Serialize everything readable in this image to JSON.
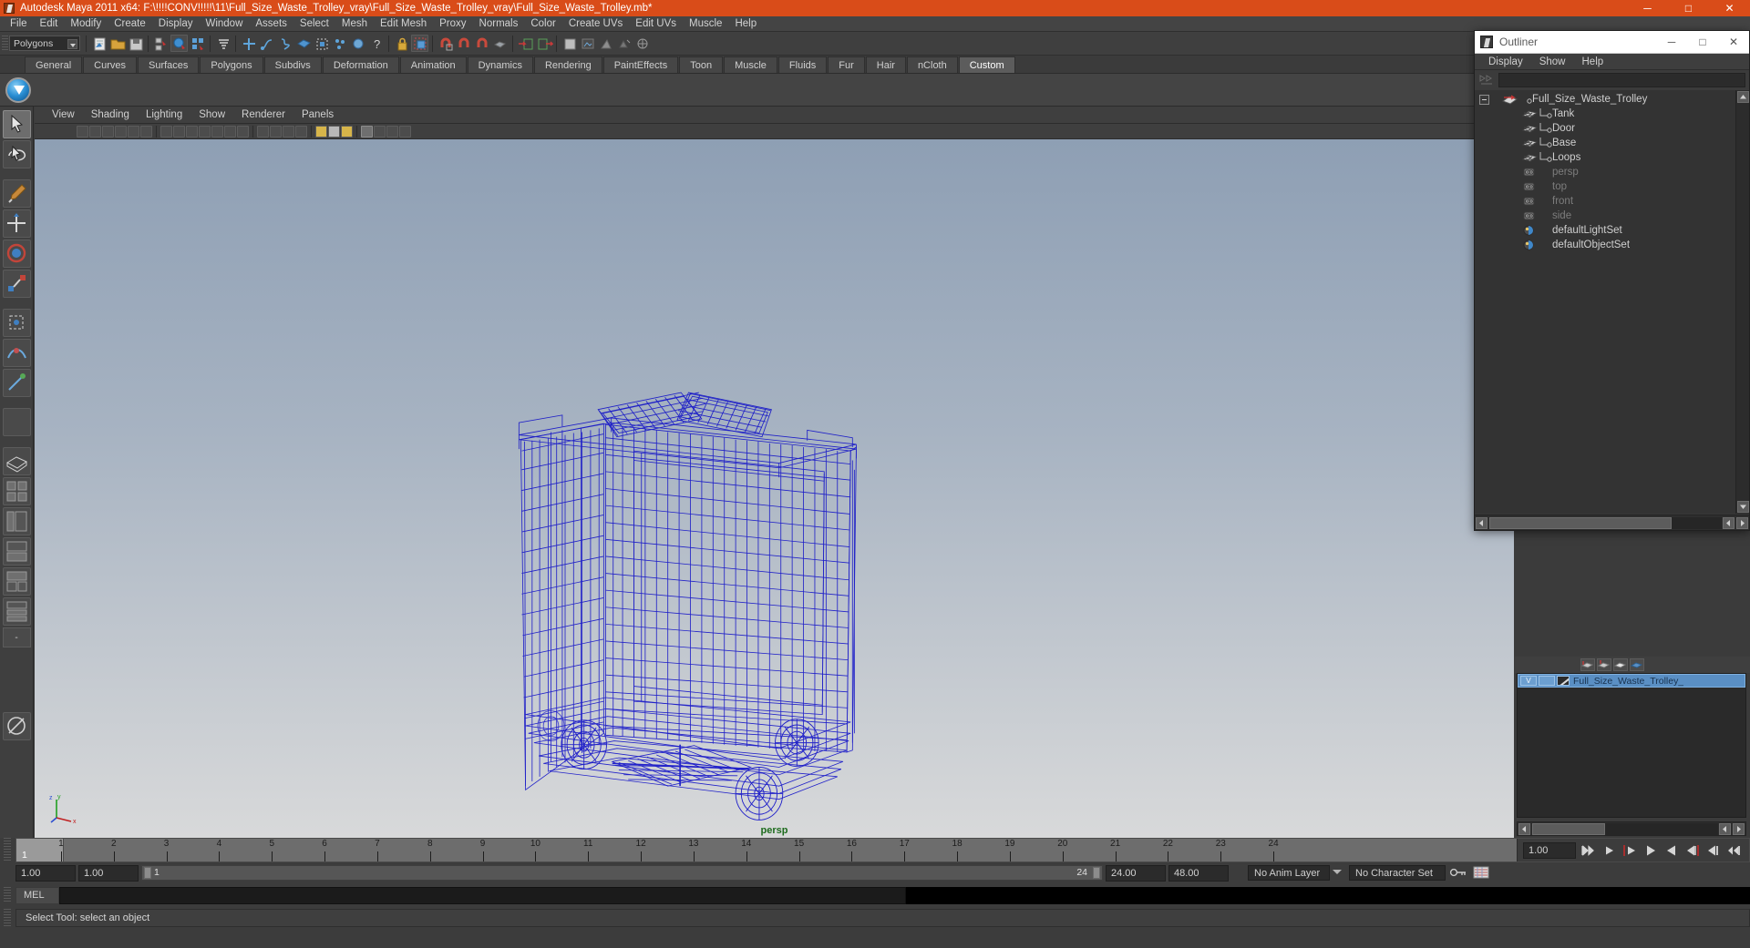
{
  "window": {
    "title": "Autodesk Maya 2011 x64: F:\\!!!!CONV!!!!!\\11\\Full_Size_Waste_Trolley_vray\\Full_Size_Waste_Trolley_vray\\Full_Size_Waste_Trolley.mb*",
    "minimize": "─",
    "maximize": "□",
    "close": "✕",
    "accent_color": "#d94c19"
  },
  "menubar": {
    "items": [
      "File",
      "Edit",
      "Modify",
      "Create",
      "Display",
      "Window",
      "Assets",
      "Select",
      "Mesh",
      "Edit Mesh",
      "Proxy",
      "Normals",
      "Color",
      "Create UVs",
      "Edit UVs",
      "Muscle",
      "Help"
    ]
  },
  "statusline": {
    "mode_selector_value": "Polygons"
  },
  "shelf": {
    "tabs": [
      "General",
      "Curves",
      "Surfaces",
      "Polygons",
      "Subdivs",
      "Deformation",
      "Animation",
      "Dynamics",
      "Rendering",
      "PaintEffects",
      "Toon",
      "Muscle",
      "Fluids",
      "Fur",
      "Hair",
      "nCloth",
      "Custom"
    ],
    "active_tab": "Custom"
  },
  "viewport": {
    "menu": [
      "View",
      "Shading",
      "Lighting",
      "Show",
      "Renderer",
      "Panels"
    ],
    "camera_label": "persp",
    "camera_label_color": "#1d6b1d",
    "wireframe_color": "#1414c8",
    "axis_labels": {
      "x": "x",
      "y": "y",
      "z": "z"
    }
  },
  "outliner": {
    "title": "Outliner",
    "minimize": "─",
    "maximize": "□",
    "close": "✕",
    "menu": [
      "Display",
      "Show",
      "Help"
    ],
    "items": [
      {
        "label": "Full_Size_Waste_Trolley",
        "icon": "transform-icon",
        "depth": 0,
        "dim": false,
        "expandable": true
      },
      {
        "label": "Tank",
        "icon": "mesh-icon",
        "depth": 1,
        "dim": false,
        "expandable": false
      },
      {
        "label": "Door",
        "icon": "mesh-icon",
        "depth": 1,
        "dim": false,
        "expandable": false
      },
      {
        "label": "Base",
        "icon": "mesh-icon",
        "depth": 1,
        "dim": false,
        "expandable": false
      },
      {
        "label": "Loops",
        "icon": "mesh-icon",
        "depth": 1,
        "dim": false,
        "expandable": false
      },
      {
        "label": "persp",
        "icon": "camera-icon",
        "depth": 1,
        "dim": true,
        "expandable": false
      },
      {
        "label": "top",
        "icon": "camera-icon",
        "depth": 1,
        "dim": true,
        "expandable": false
      },
      {
        "label": "front",
        "icon": "camera-icon",
        "depth": 1,
        "dim": true,
        "expandable": false
      },
      {
        "label": "side",
        "icon": "camera-icon",
        "depth": 1,
        "dim": true,
        "expandable": false
      },
      {
        "label": "defaultLightSet",
        "icon": "set-icon",
        "depth": 1,
        "dim": false,
        "expandable": false
      },
      {
        "label": "defaultObjectSet",
        "icon": "set-icon",
        "depth": 1,
        "dim": false,
        "expandable": false
      }
    ]
  },
  "layer_editor": {
    "rows": [
      {
        "visibility": "V",
        "playback": "",
        "name": "Full_Size_Waste_Trolley_"
      }
    ]
  },
  "timeline": {
    "ticks": [
      1,
      2,
      3,
      4,
      5,
      6,
      7,
      8,
      9,
      10,
      11,
      12,
      13,
      14,
      15,
      16,
      17,
      18,
      19,
      20,
      21,
      22,
      23,
      24
    ],
    "current_frame": "1",
    "current_frame_field": "1.00",
    "range_start_field": "1.00",
    "range_end_field": "1.00",
    "range_bar_start": "1",
    "range_bar_end": "24",
    "anim_start_field": "24.00",
    "anim_end_field": "48.00",
    "anim_layer": "No Anim Layer",
    "character_set": "No Character Set"
  },
  "command_line": {
    "label": "MEL",
    "value": ""
  },
  "statusbar": {
    "message": "Select Tool: select an object"
  }
}
